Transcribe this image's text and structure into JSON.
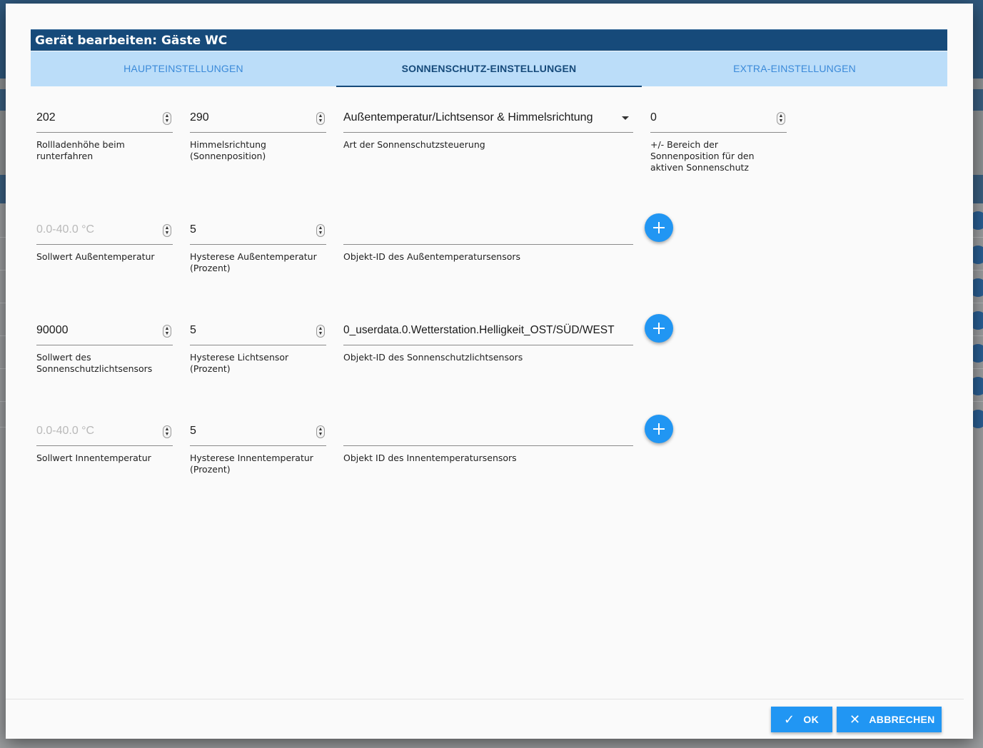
{
  "dialog": {
    "title": "Gerät bearbeiten: Gäste WC",
    "tabs": [
      {
        "label": "HAUPTEINSTELLUNGEN"
      },
      {
        "label": "SONNENSCHUTZ-EINSTELLUNGEN",
        "active": true
      },
      {
        "label": "EXTRA-EINSTELLUNGEN"
      }
    ],
    "row1": {
      "height": {
        "value": "202",
        "label": "Rollladenhöhe beim\nrunterfahren"
      },
      "direction": {
        "value": "290",
        "label": "Himmelsrichtung\n(Sonnenposition)"
      },
      "type": {
        "value": "Außentemperatur/Lichtsensor & Himmelsrichtung",
        "label": "Art der Sonnenschutzsteuerung"
      },
      "range": {
        "value": "0",
        "label": "+/- Bereich der\nSonnenposition für den\naktiven Sonnenschutz"
      }
    },
    "row2": {
      "setpoint": {
        "placeholder": "0.0-40.0 °C",
        "label": "Sollwert Außentemperatur"
      },
      "hysteresis": {
        "value": "5",
        "label": "Hysterese Außentemperatur\n(Prozent)"
      },
      "object_id": {
        "value": "",
        "label": "Objekt-ID des Außentemperatursensors"
      }
    },
    "row3": {
      "setpoint": {
        "value": "90000",
        "label": "Sollwert des\nSonnenschutzlichtsensors"
      },
      "hysteresis": {
        "value": "5",
        "label": "Hysterese Lichtsensor\n(Prozent)"
      },
      "object_id": {
        "value": "0_userdata.0.Wetterstation.Helligkeit_OST/SÜD/WEST",
        "label": "Objekt-ID des Sonnenschutzlichtsensors"
      }
    },
    "row4": {
      "setpoint": {
        "placeholder": "0.0-40.0 °C",
        "label": "Sollwert Innentemperatur"
      },
      "hysteresis": {
        "value": "5",
        "label": "Hysterese Innentemperatur\n(Prozent)"
      },
      "object_id": {
        "value": "",
        "label": "Objekt ID des Innentemperatursensors"
      }
    },
    "buttons": {
      "ok": "OK",
      "cancel": "ABBRECHEN"
    }
  },
  "colors": {
    "accent": "#2196f3",
    "title_bar": "#164a7a",
    "tab_bar": "#bbddf9"
  }
}
